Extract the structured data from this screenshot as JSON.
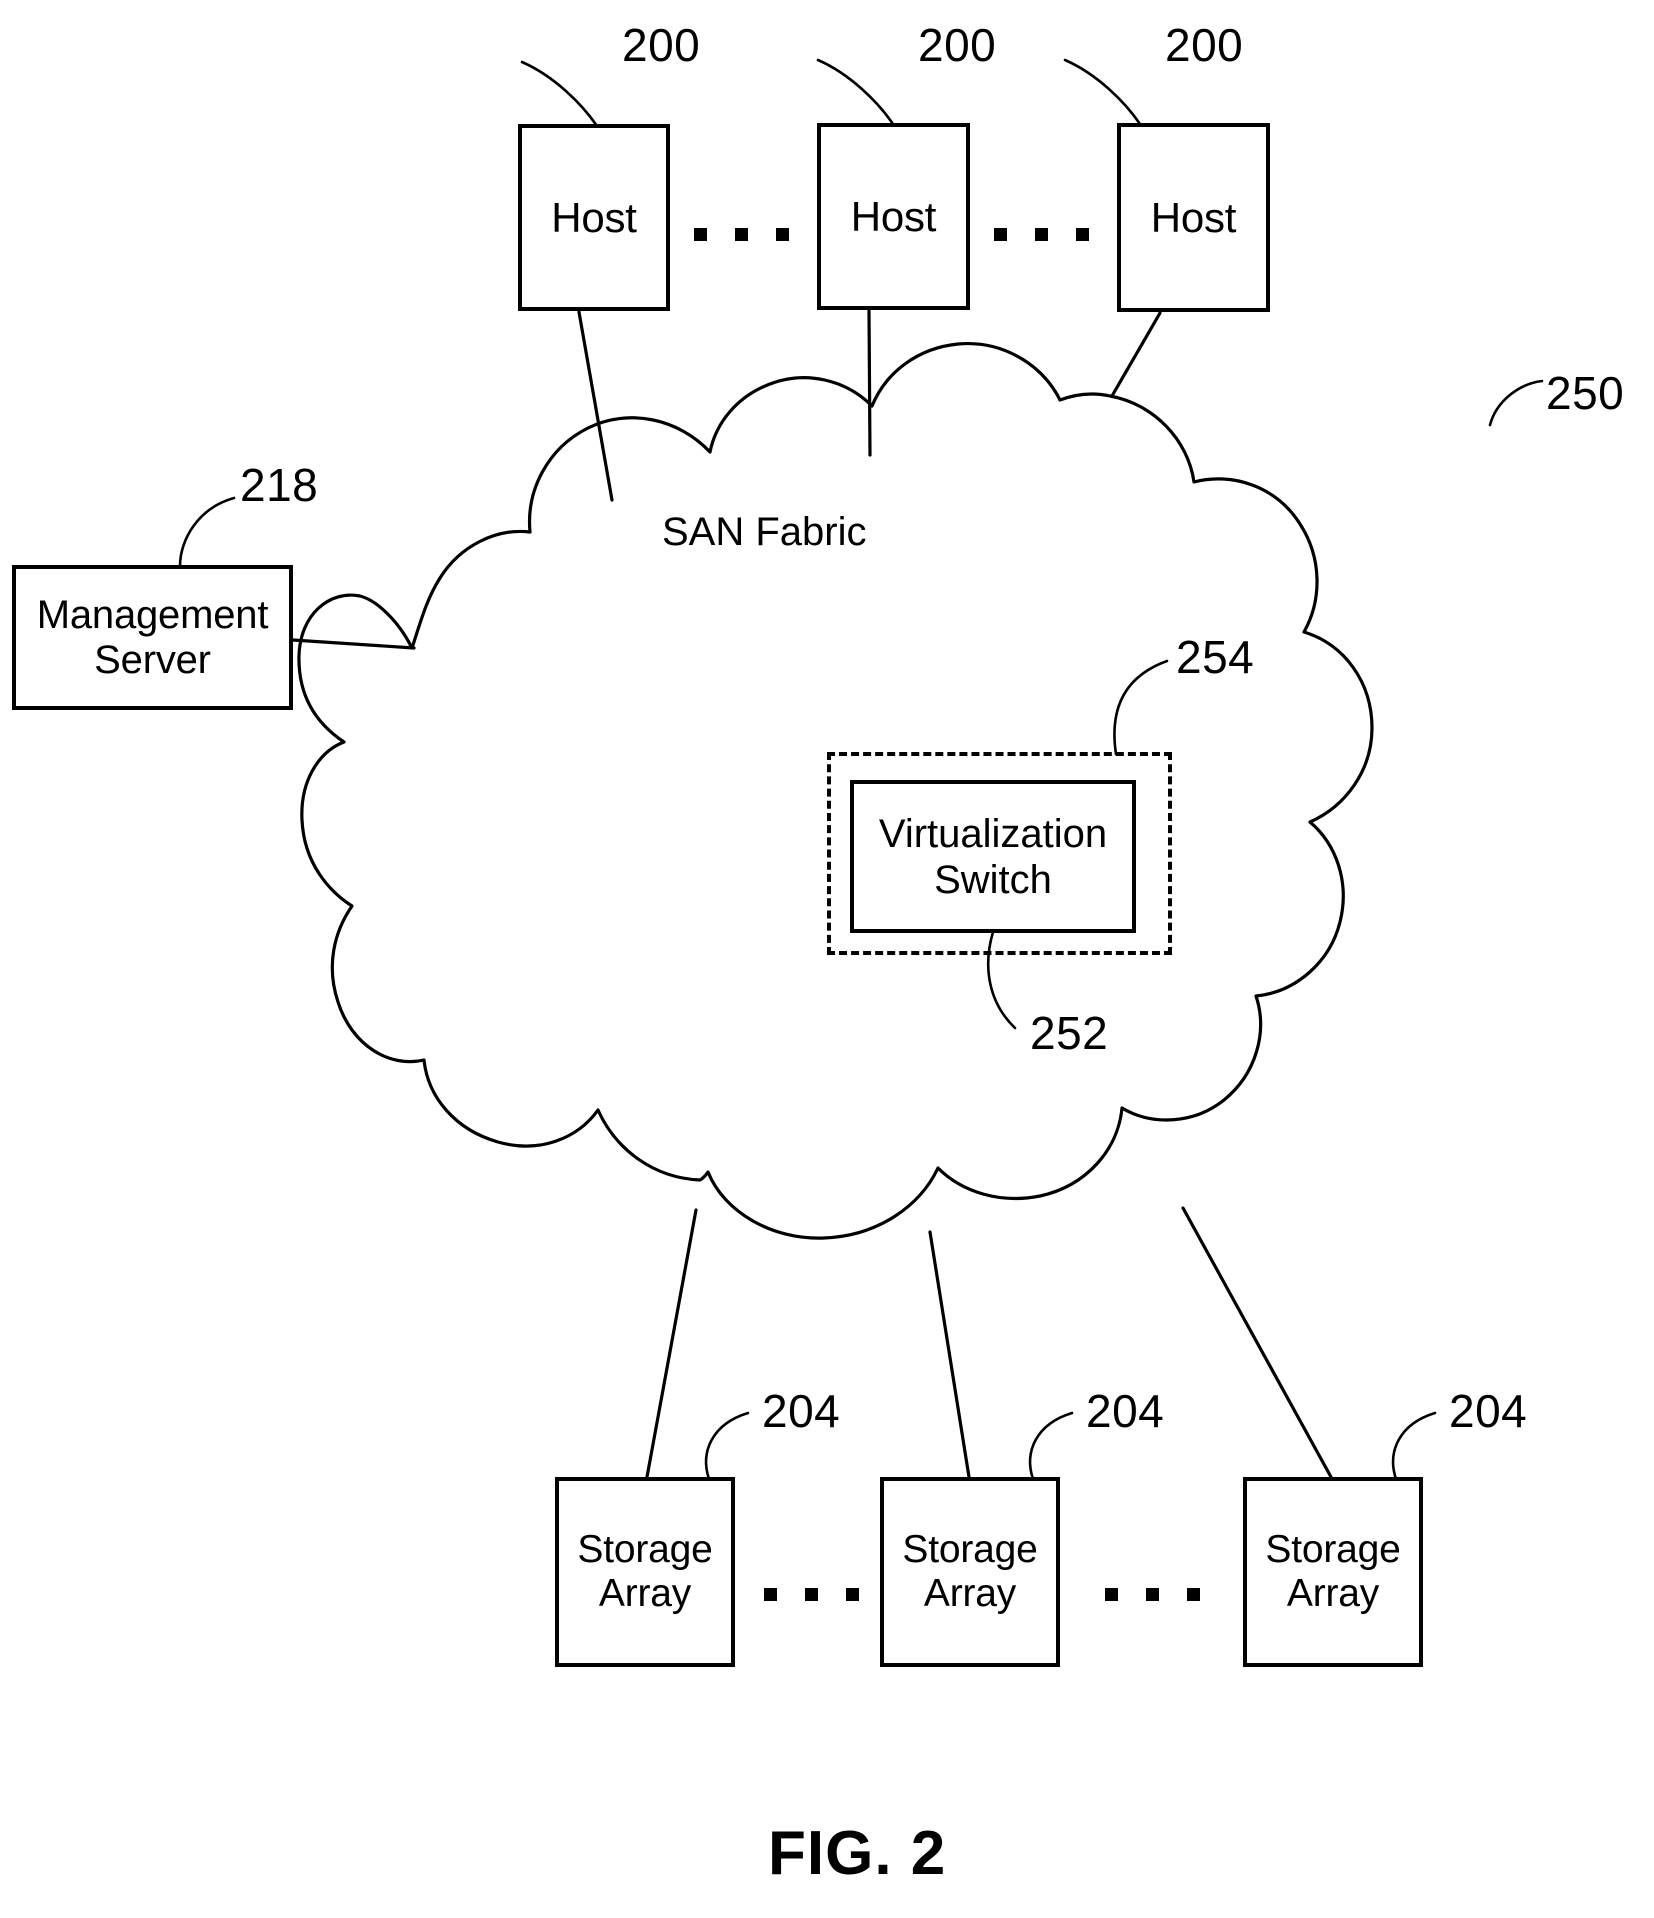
{
  "figure": {
    "caption": "FIG. 2",
    "cloud_title": "SAN Fabric"
  },
  "nodes": {
    "hosts": [
      {
        "label": "Host",
        "ref": "200"
      },
      {
        "label": "Host",
        "ref": "200"
      },
      {
        "label": "Host",
        "ref": "200"
      }
    ],
    "management_server": {
      "label": "Management\nServer",
      "ref": "218"
    },
    "san_fabric": {
      "label": "SAN Fabric",
      "ref": "250"
    },
    "virtualization_switch": {
      "label": "Virtualization\nSwitch",
      "ref": "252"
    },
    "virtualization_boundary": {
      "ref": "254"
    },
    "storage_arrays": [
      {
        "label": "Storage\nArray",
        "ref": "204"
      },
      {
        "label": "Storage\nArray",
        "ref": "204"
      },
      {
        "label": "Storage\nArray",
        "ref": "204"
      }
    ]
  },
  "ellipses": {
    "hosts_1": "• • •",
    "hosts_2": "• • •",
    "storage_1": "• • •",
    "storage_2": "• • •"
  },
  "colors": {
    "ink": "#000000",
    "paper": "#ffffff"
  }
}
